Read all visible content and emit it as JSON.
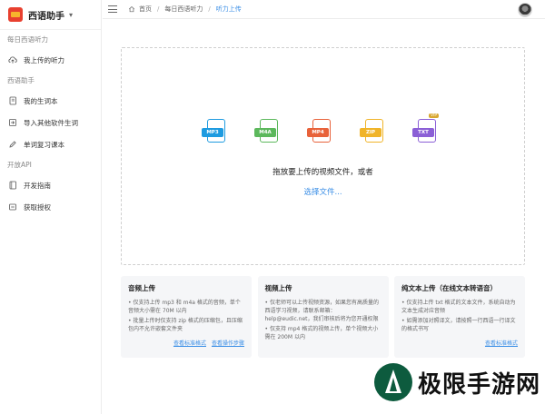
{
  "app": {
    "name": "西语助手"
  },
  "sidebar": {
    "groups": [
      {
        "title": "每日西语听力",
        "items": [
          {
            "label": "我上传的听力",
            "icon": "cloud-upload-icon"
          }
        ]
      },
      {
        "title": "西语助手",
        "items": [
          {
            "label": "我的生词本",
            "icon": "notebook-icon"
          },
          {
            "label": "导入其他软件生词",
            "icon": "import-icon"
          },
          {
            "label": "单词复习课本",
            "icon": "pencil-icon"
          }
        ]
      },
      {
        "title": "开放API",
        "items": [
          {
            "label": "开发指南",
            "icon": "book-icon"
          },
          {
            "label": "获取授权",
            "icon": "key-icon"
          }
        ]
      }
    ]
  },
  "breadcrumb": {
    "home": "首页",
    "level1": "每日西语听力",
    "level2": "听力上传"
  },
  "dropzone": {
    "formats": [
      {
        "label": "MP3",
        "color": "#1e9be0"
      },
      {
        "label": "M4A",
        "color": "#5cb85c"
      },
      {
        "label": "MP4",
        "color": "#e8623a"
      },
      {
        "label": "ZIP",
        "color": "#f0b429"
      },
      {
        "label": "TXT",
        "color": "#8b5fd6",
        "badge": "VIP"
      }
    ],
    "hint": "拖放要上传的视频文件，或者",
    "pick_label": "选择文件..."
  },
  "cards": [
    {
      "title": "音频上传",
      "lines": [
        "• 仅支持上传 mp3 和 m4a 格式的音频，单个音频大小需在 70M 以内",
        "• 批量上传时仅支持 zip 格式的压缩包，且压缩包内不允许嵌套文件夹"
      ],
      "links": [
        "查看标准格式",
        "查看操作步骤"
      ]
    },
    {
      "title": "视频上传",
      "lines": [
        "• 仅老师可以上传视频资源，如果您有高质量的西语学习视频，请联系邮箱：help@eudic.net，我们审核后将为您开通权限",
        "• 仅支持 mp4 格式的视频上传，单个视频大小需在 200M 以内"
      ],
      "links": []
    },
    {
      "title": "纯文本上传（在线文本转语音）",
      "lines": [
        "• 仅支持上传 txt 格式的文本文件，系统自动为文本生成对应音频",
        "• 如需添加对照译文，请按照一行西语一行译文的格式书写"
      ],
      "links": [
        "查看标准格式"
      ]
    }
  ],
  "watermark": {
    "text": "极限手游网"
  }
}
